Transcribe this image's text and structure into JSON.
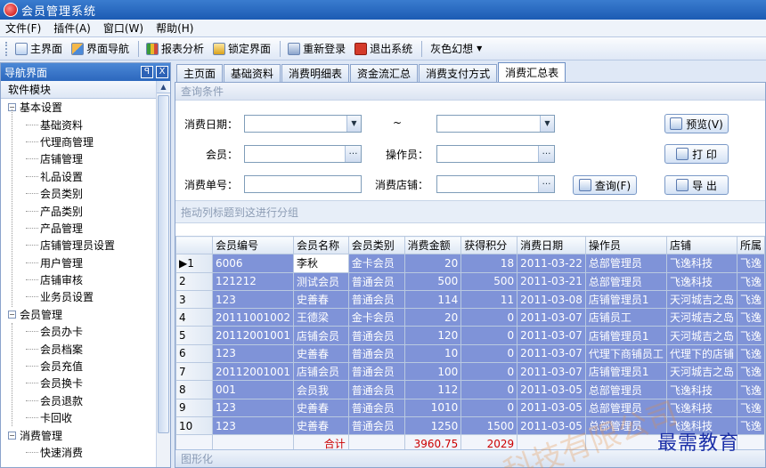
{
  "window": {
    "title": "会员管理系统"
  },
  "menu": [
    "文件(F)",
    "插件(A)",
    "窗口(W)",
    "帮助(H)"
  ],
  "toolbar": {
    "home": "主界面",
    "nav": "界面导航",
    "report": "报表分析",
    "lock": "锁定界面",
    "relogin": "重新登录",
    "exit": "退出系统",
    "theme": "灰色幻想"
  },
  "nav": {
    "header": "导航界面",
    "pin": "ꟼ",
    "close": "X",
    "section": "软件模块",
    "groups": [
      {
        "label": "基本设置",
        "items": [
          "基础资料",
          "代理商管理",
          "店铺管理",
          "礼品设置",
          "会员类别",
          "产品类别",
          "产品管理",
          "店铺管理员设置",
          "用户管理",
          "店铺审核",
          "业务员设置"
        ]
      },
      {
        "label": "会员管理",
        "items": [
          "会员办卡",
          "会员档案",
          "会员充值",
          "会员换卡",
          "会员退款",
          "卡回收"
        ]
      },
      {
        "label": "消费管理",
        "items": [
          "快速消费"
        ]
      }
    ]
  },
  "tabs": [
    "主页面",
    "基础资料",
    "消费明细表",
    "资金流汇总",
    "消费支付方式",
    "消费汇总表"
  ],
  "query": {
    "header": "查询条件",
    "date_label": "消费日期：",
    "tilde": "~",
    "member_label": "会员：",
    "operator_label": "操作员：",
    "order_label": "消费单号：",
    "store_label": "消费店铺：",
    "btn_preview": "预览(V)",
    "btn_print": "打 印",
    "btn_export": "导 出",
    "btn_query": "查询(F)"
  },
  "grid": {
    "grouping_hint": "拖动列标题到这进行分组",
    "columns": [
      "",
      "会员编号",
      "会员名称",
      "会员类别",
      "消费金额",
      "获得积分",
      "消费日期",
      "操作员",
      "店铺",
      "所属"
    ],
    "rows": [
      [
        "▶1",
        "6006",
        "李秋",
        "金卡会员",
        "20",
        "18",
        "2011-03-22",
        "总部管理员",
        "飞逸科技",
        "飞逸"
      ],
      [
        "2",
        "121212",
        "测试会员",
        "普通会员",
        "500",
        "500",
        "2011-03-21",
        "总部管理员",
        "飞逸科技",
        "飞逸"
      ],
      [
        "3",
        "123",
        "史善春",
        "普通会员",
        "114",
        "11",
        "2011-03-08",
        "店铺管理员1",
        "天河城吉之岛",
        "飞逸"
      ],
      [
        "4",
        "20111001002",
        "王德梁",
        "金卡会员",
        "20",
        "0",
        "2011-03-07",
        "店铺员工",
        "天河城吉之岛",
        "飞逸"
      ],
      [
        "5",
        "20112001001",
        "店铺会员",
        "普通会员",
        "120",
        "0",
        "2011-03-07",
        "店铺管理员1",
        "天河城吉之岛",
        "飞逸"
      ],
      [
        "6",
        "123",
        "史善春",
        "普通会员",
        "10",
        "0",
        "2011-03-07",
        "代理下商铺员工",
        "代理下的店铺",
        "飞逸"
      ],
      [
        "7",
        "20112001001",
        "店铺会员",
        "普通会员",
        "100",
        "0",
        "2011-03-07",
        "店铺管理员1",
        "天河城吉之岛",
        "飞逸"
      ],
      [
        "8",
        "001",
        "会员我",
        "普通会员",
        "112",
        "0",
        "2011-03-05",
        "总部管理员",
        "飞逸科技",
        "飞逸"
      ],
      [
        "9",
        "123",
        "史善春",
        "普通会员",
        "1010",
        "0",
        "2011-03-05",
        "总部管理员",
        "飞逸科技",
        "飞逸"
      ],
      [
        "10",
        "123",
        "史善春",
        "普通会员",
        "1250",
        "1500",
        "2011-03-05",
        "总部管理员",
        "飞逸科技",
        "飞逸"
      ]
    ],
    "footer_label": "合计",
    "footer_amount": "3960.75",
    "footer_points": "2029",
    "bottom_label": "图形化"
  },
  "watermark": "最需教育",
  "watermark_faint": "科技有限公司"
}
